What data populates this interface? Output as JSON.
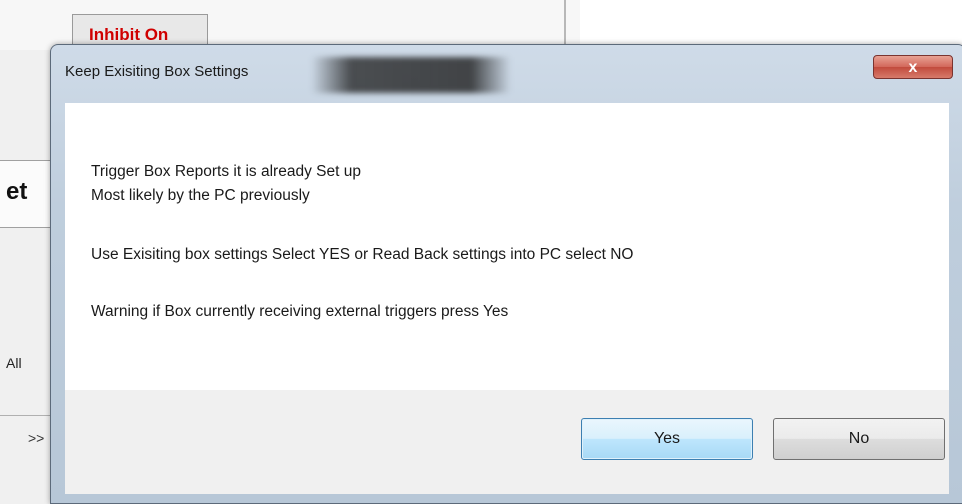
{
  "background": {
    "inhibit_label": "Inhibit On",
    "tab_label": "et",
    "all_label": "All",
    "arrow_label": ">>"
  },
  "dialog": {
    "title": "Keep Exisiting Box Settings",
    "close_glyph": "x",
    "messages": [
      "Trigger Box Reports it is already Set up",
      "Most likely by the PC previously",
      "Use Exisiting box settings Select YES or Read Back settings into PC select NO",
      "Warning if Box currently receiving external triggers press Yes"
    ],
    "buttons": {
      "yes": "Yes",
      "no": "No"
    }
  },
  "colors": {
    "inhibit_text": "#d00000",
    "close_button": "#c14b3d",
    "default_button_border": "#3c7fb1"
  }
}
